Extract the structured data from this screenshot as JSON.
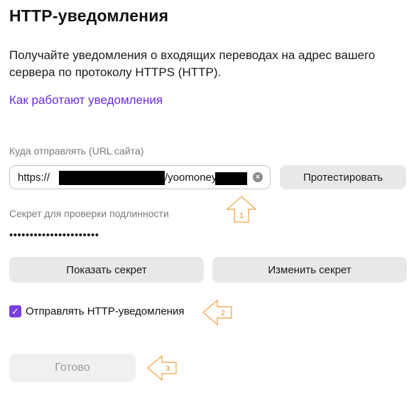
{
  "title": "HTTP-уведомления",
  "description": "Получайте уведомления о входящих переводах на адрес вашего сервера по протоколу HTTPS (HTTP).",
  "help_link": "Как работают уведомления",
  "url_field": {
    "label": "Куда отправлять (URL сайта)",
    "value_prefix": "https://",
    "value_middle": "/yoomoney",
    "clear_icon": "clear-icon"
  },
  "test_button": "Протестировать",
  "secret": {
    "label": "Секрет для проверки подлинности",
    "masked_value": "••••••••••••••••••••••"
  },
  "show_secret_button": "Показать секрет",
  "change_secret_button": "Изменить секрет",
  "send_checkbox": {
    "label": "Отправлять HTTP-уведомления",
    "checked": true
  },
  "done_button": "Готово",
  "annotations": [
    "1",
    "2",
    "3"
  ],
  "colors": {
    "accent": "#7b3fe0",
    "link": "#6a2bd9",
    "annotation": "#f0a040"
  }
}
